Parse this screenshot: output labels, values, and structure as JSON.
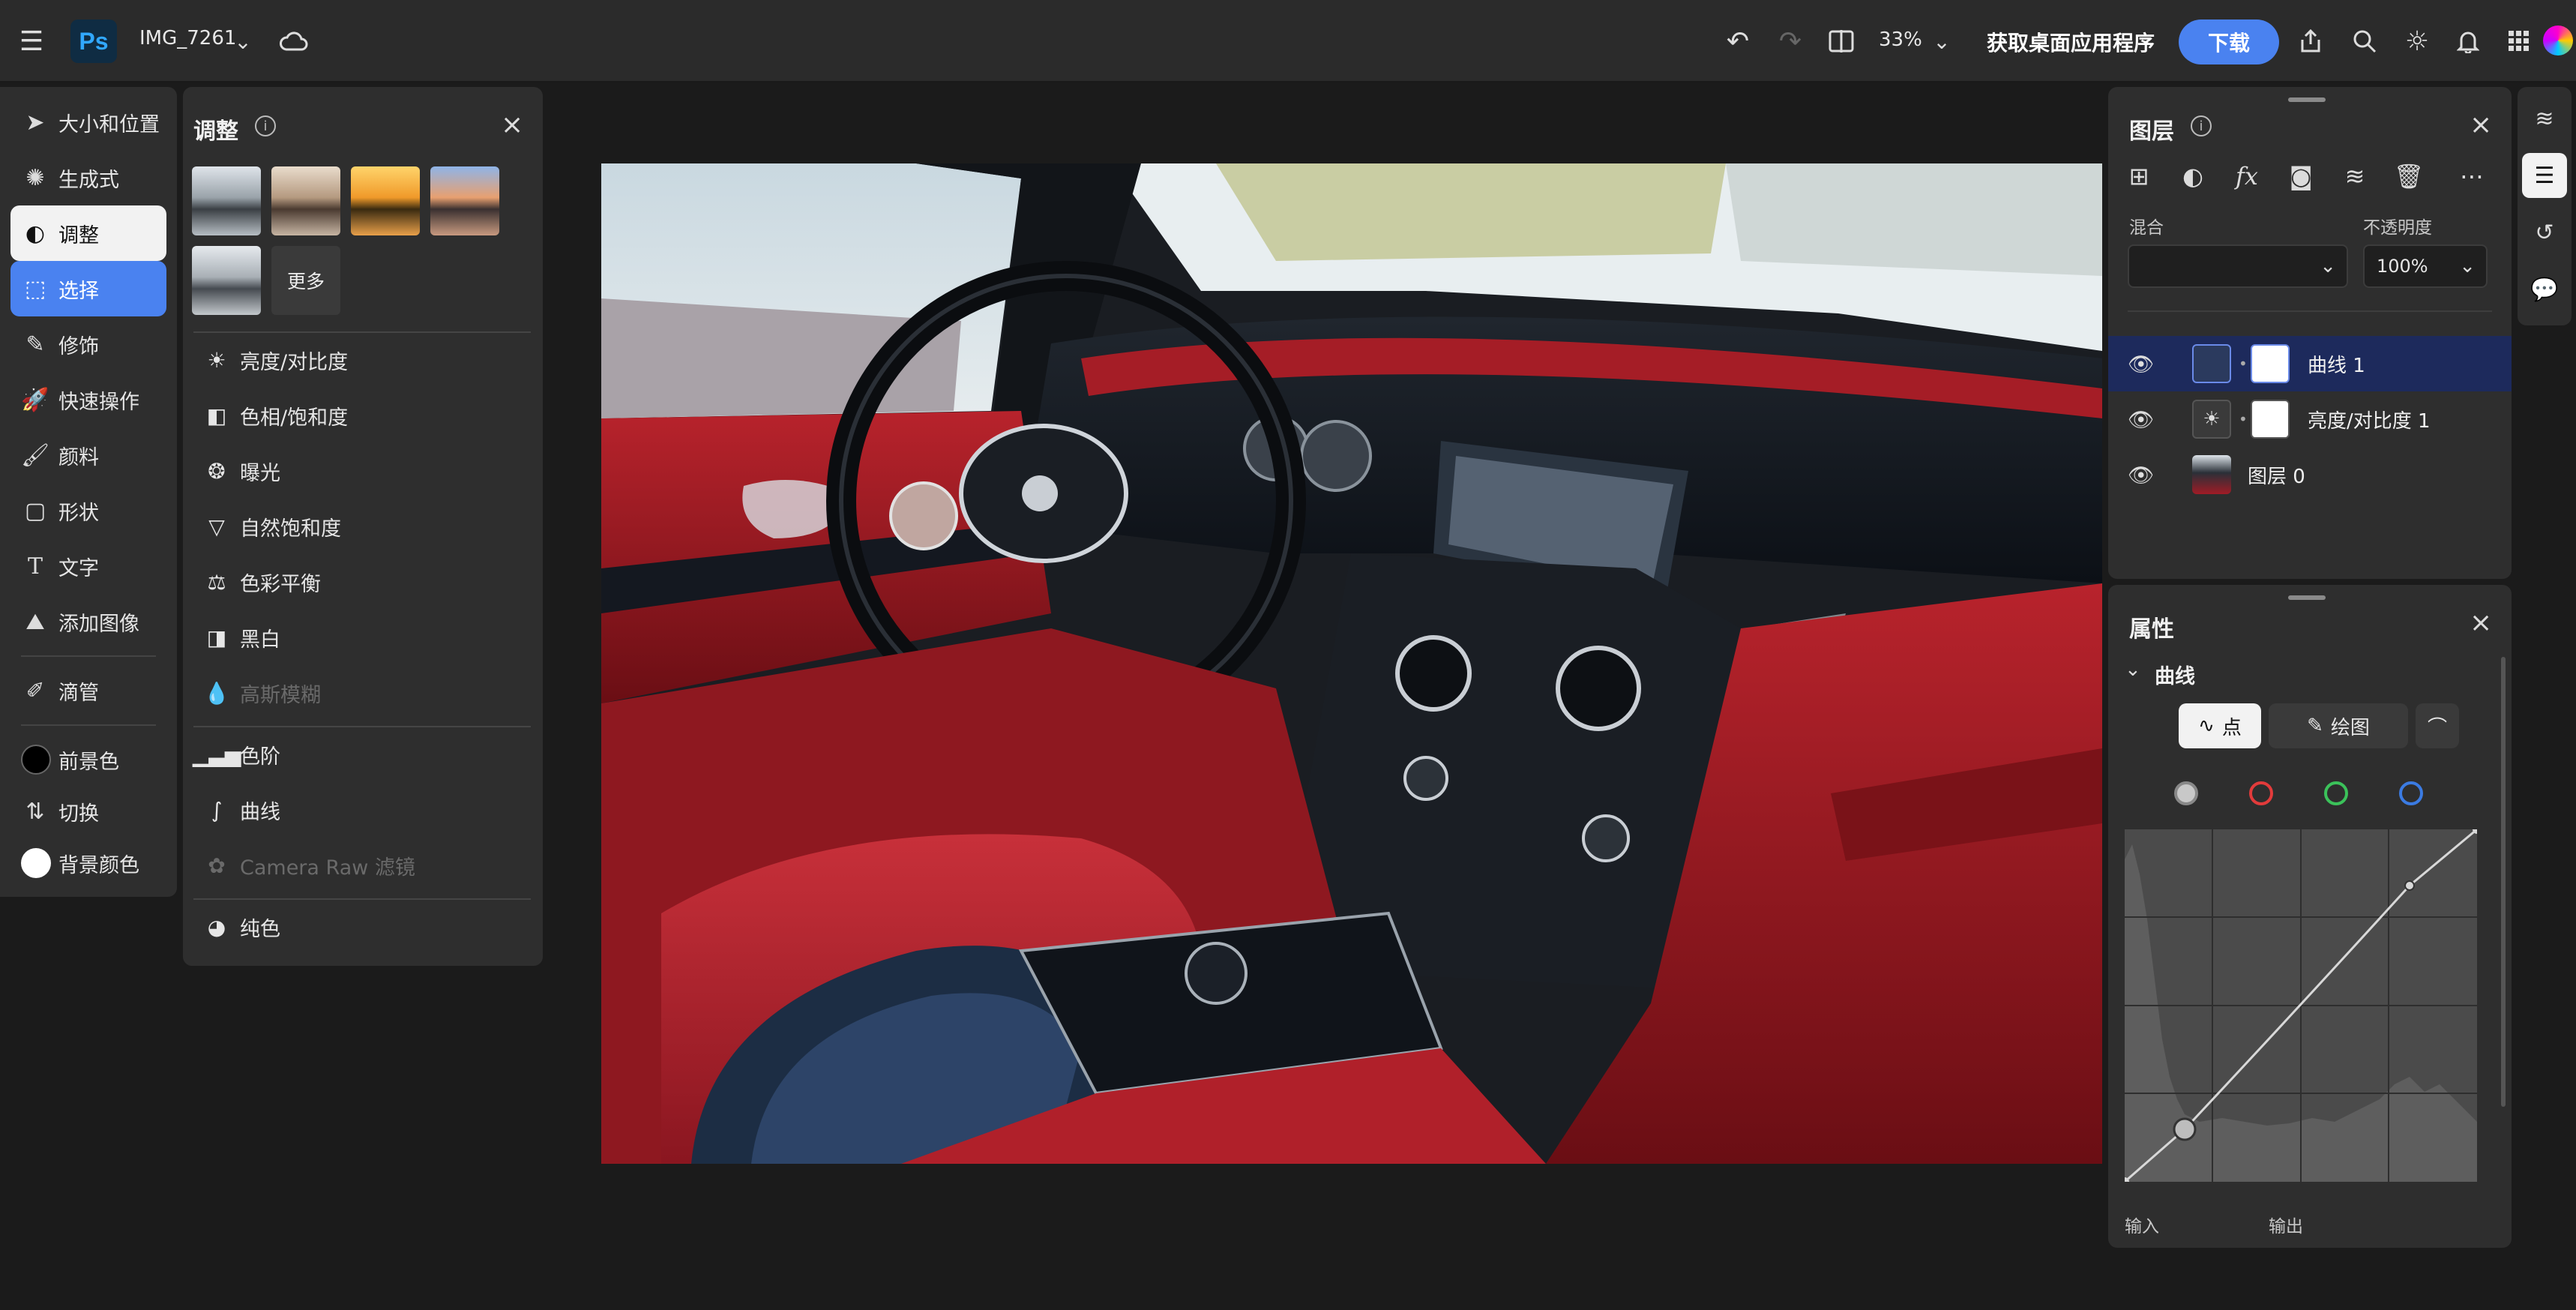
{
  "app": {
    "logo_text": "Ps",
    "document_title": "IMG_7261",
    "zoom": "33%",
    "desktop_button": "获取桌面应用程序",
    "download_button": "下载"
  },
  "toolbar": {
    "items": [
      {
        "label": "大小和位置",
        "icon": "move-icon"
      },
      {
        "label": "生成式",
        "icon": "generative-icon"
      },
      {
        "label": "调整",
        "icon": "adjust-icon"
      },
      {
        "label": "选择",
        "icon": "select-icon"
      },
      {
        "label": "修饰",
        "icon": "retouch-icon"
      },
      {
        "label": "快速操作",
        "icon": "quick-action-icon"
      },
      {
        "label": "颜料",
        "icon": "brush-icon"
      },
      {
        "label": "形状",
        "icon": "shape-icon"
      },
      {
        "label": "文字",
        "icon": "text-icon"
      },
      {
        "label": "添加图像",
        "icon": "add-image-icon"
      },
      {
        "label": "滴管",
        "icon": "eyedropper-icon"
      }
    ],
    "foreground_label": "前景色",
    "switch_label": "切换",
    "background_label": "背景颜色",
    "foreground_color": "#000000",
    "background_color": "#ffffff"
  },
  "adjustments": {
    "title": "调整",
    "more_label": "更多",
    "items": [
      {
        "label": "亮度/对比度",
        "icon": "brightness-icon"
      },
      {
        "label": "色相/饱和度",
        "icon": "hue-saturation-icon"
      },
      {
        "label": "曝光",
        "icon": "exposure-icon"
      },
      {
        "label": "自然饱和度",
        "icon": "vibrance-icon"
      },
      {
        "label": "色彩平衡",
        "icon": "color-balance-icon"
      },
      {
        "label": "黑白",
        "icon": "black-white-icon"
      },
      {
        "label": "高斯模糊",
        "icon": "gaussian-blur-icon",
        "disabled": true
      },
      {
        "label": "色阶",
        "icon": "levels-icon"
      },
      {
        "label": "曲线",
        "icon": "curves-icon"
      },
      {
        "label": "Camera Raw 滤镜",
        "icon": "camera-raw-icon",
        "disabled": true
      },
      {
        "label": "纯色",
        "icon": "solid-color-icon"
      }
    ]
  },
  "layers": {
    "title": "图层",
    "blend_label": "混合",
    "blend_value": "",
    "opacity_label": "不透明度",
    "opacity_value": "100%",
    "rows": [
      {
        "name": "曲线 1",
        "selected": true
      },
      {
        "name": "亮度/对比度 1",
        "selected": false
      },
      {
        "name": "图层 0",
        "selected": false
      }
    ]
  },
  "properties": {
    "title": "属性",
    "section": "曲线",
    "mode_point": "点",
    "mode_draw": "绘图",
    "input_label": "输入",
    "output_label": "输出",
    "channels": [
      "#c8c8c8",
      "#e23b3b",
      "#3bc25a",
      "#3b7be2"
    ]
  },
  "colors": {
    "accent_blue": "#4a82f0",
    "selected_row": "#1d2a5c",
    "panel_bg": "#2e2e2e"
  }
}
